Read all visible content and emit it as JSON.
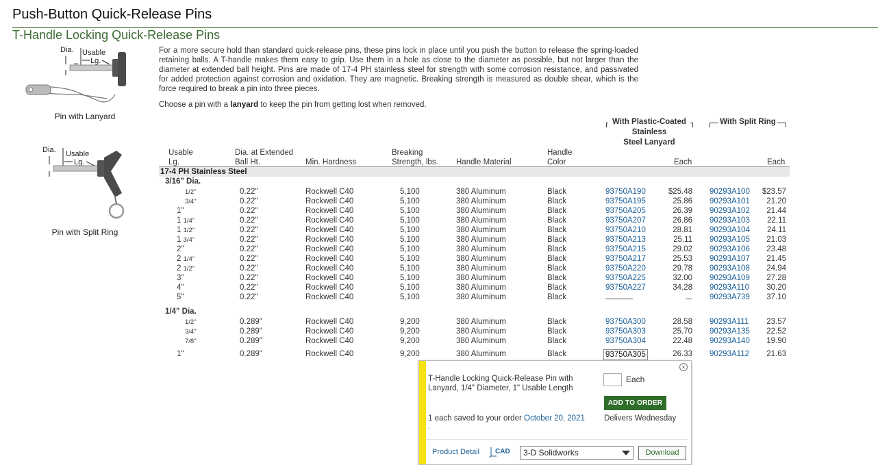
{
  "page_title": "Push-Button Quick-Release Pins",
  "sub_title": "T-Handle Locking Quick-Release Pins",
  "images": {
    "lanyard": {
      "label_dia": "Dia.",
      "label_usable": "Usable",
      "label_lg": "Lg.",
      "caption": "Pin with Lanyard"
    },
    "split_ring": {
      "label_dia": "Dia.",
      "label_usable": "Usable",
      "label_lg": "Lg.",
      "caption": "Pin with Split Ring"
    }
  },
  "description": "For a more secure hold than standard quick-release pins, these pins lock in place until you push the button to release the spring-loaded retaining balls. A T-handle makes them easy to grip. Use them in a hole as close to the diameter as possible, but not larger than the diameter at extended ball height. Pins are made of 17-4 PH stainless steel for strength with some corrosion resistance, and passivated for added protection against corrosion and oxidation. They are magnetic. Breaking strength is measured as double shear, which is the force required to break a pin into three pieces.",
  "choose": {
    "before": "Choose a pin with a ",
    "bold": "lanyard",
    "after": " to keep the pin from getting lost when removed."
  },
  "table": {
    "group_headers": {
      "lanyard": [
        "With Plastic-Coated",
        "Stainless",
        "Steel Lanyard"
      ],
      "split_ring": "With Split Ring"
    },
    "headers": {
      "usable_lg": [
        "Usable",
        "Lg."
      ],
      "dia": [
        "Dia. at Extended",
        "Ball Ht."
      ],
      "hardness": "Min. Hardness",
      "breaking": [
        "Breaking",
        "Strength, lbs."
      ],
      "material": "Handle Material",
      "color": [
        "Handle",
        "Color"
      ],
      "each1": "Each",
      "each2": "Each"
    },
    "material_row": "17-4 PH Stainless Steel",
    "sections": [
      {
        "dia_label": "3/16\" Dia.",
        "rows": [
          {
            "whole": "",
            "frac": "1/2\"",
            "dia": "0.22\"",
            "hard": "Rockwell C40",
            "brk": "5,100",
            "mat": "380 Aluminum",
            "col": "Black",
            "p1": "93750A190",
            "e1": "$25.48",
            "p2": "90293A100",
            "e2": "$23.57"
          },
          {
            "whole": "",
            "frac": "3/4\"",
            "dia": "0.22\"",
            "hard": "Rockwell C40",
            "brk": "5,100",
            "mat": "380 Aluminum",
            "col": "Black",
            "p1": "93750A195",
            "e1": "25.86",
            "p2": "90293A101",
            "e2": "21.20"
          },
          {
            "whole": "1\"",
            "frac": "",
            "dia": "0.22\"",
            "hard": "Rockwell C40",
            "brk": "5,100",
            "mat": "380 Aluminum",
            "col": "Black",
            "p1": "93750A205",
            "e1": "26.39",
            "p2": "90293A102",
            "e2": "21.44"
          },
          {
            "whole": "1 ",
            "frac": "1/4\"",
            "dia": "0.22\"",
            "hard": "Rockwell C40",
            "brk": "5,100",
            "mat": "380 Aluminum",
            "col": "Black",
            "p1": "93750A207",
            "e1": "26.86",
            "p2": "90293A103",
            "e2": "22.11"
          },
          {
            "whole": "1 ",
            "frac": "1/2\"",
            "dia": "0.22\"",
            "hard": "Rockwell C40",
            "brk": "5,100",
            "mat": "380 Aluminum",
            "col": "Black",
            "p1": "93750A210",
            "e1": "28.81",
            "p2": "90293A104",
            "e2": "24.11"
          },
          {
            "whole": "1 ",
            "frac": "3/4\"",
            "dia": "0.22\"",
            "hard": "Rockwell C40",
            "brk": "5,100",
            "mat": "380 Aluminum",
            "col": "Black",
            "p1": "93750A213",
            "e1": "25.11",
            "p2": "90293A105",
            "e2": "21.03"
          },
          {
            "whole": "2\"",
            "frac": "",
            "dia": "0.22\"",
            "hard": "Rockwell C40",
            "brk": "5,100",
            "mat": "380 Aluminum",
            "col": "Black",
            "p1": "93750A215",
            "e1": "29.02",
            "p2": "90293A106",
            "e2": "23.48"
          },
          {
            "whole": "2 ",
            "frac": "1/4\"",
            "dia": "0.22\"",
            "hard": "Rockwell C40",
            "brk": "5,100",
            "mat": "380 Aluminum",
            "col": "Black",
            "p1": "93750A217",
            "e1": "25.53",
            "p2": "90293A107",
            "e2": "21.45"
          },
          {
            "whole": "2 ",
            "frac": "1/2\"",
            "dia": "0.22\"",
            "hard": "Rockwell C40",
            "brk": "5,100",
            "mat": "380 Aluminum",
            "col": "Black",
            "p1": "93750A220",
            "e1": "29.78",
            "p2": "90293A108",
            "e2": "24.94"
          },
          {
            "whole": "3\"",
            "frac": "",
            "dia": "0.22\"",
            "hard": "Rockwell C40",
            "brk": "5,100",
            "mat": "380 Aluminum",
            "col": "Black",
            "p1": "93750A225",
            "e1": "32.00",
            "p2": "90293A109",
            "e2": "27.28"
          },
          {
            "whole": "4\"",
            "frac": "",
            "dia": "0.22\"",
            "hard": "Rockwell C40",
            "brk": "5,100",
            "mat": "380 Aluminum",
            "col": "Black",
            "p1": "93750A227",
            "e1": "34.28",
            "p2": "90293A110",
            "e2": "30.20"
          },
          {
            "whole": "5\"",
            "frac": "",
            "dia": "0.22\"",
            "hard": "Rockwell C40",
            "brk": "5,100",
            "mat": "380 Aluminum",
            "col": "Black",
            "p1": "",
            "e1": "",
            "p2": "90293A739",
            "e2": "37.10"
          }
        ]
      },
      {
        "dia_label": "1/4\" Dia.",
        "rows": [
          {
            "whole": "",
            "frac": "1/2\"",
            "dia": "0.289\"",
            "hard": "Rockwell C40",
            "brk": "9,200",
            "mat": "380 Aluminum",
            "col": "Black",
            "p1": "93750A300",
            "e1": "28.58",
            "p2": "90293A111",
            "e2": "23.57"
          },
          {
            "whole": "",
            "frac": "3/4\"",
            "dia": "0.289\"",
            "hard": "Rockwell C40",
            "brk": "9,200",
            "mat": "380 Aluminum",
            "col": "Black",
            "p1": "93750A303",
            "e1": "25.70",
            "p2": "90293A135",
            "e2": "22.52"
          },
          {
            "whole": "",
            "frac": "7/8\"",
            "dia": "0.289\"",
            "hard": "Rockwell C40",
            "brk": "9,200",
            "mat": "380 Aluminum",
            "col": "Black",
            "p1": "93750A304",
            "e1": "22.48",
            "p2": "90293A140",
            "e2": "19.90"
          },
          {
            "whole": "1\"",
            "frac": "",
            "dia": "0.289\"",
            "hard": "Rockwell C40",
            "brk": "9,200",
            "mat": "380 Aluminum",
            "col": "Black",
            "p1": "93750A305",
            "e1": "26.33",
            "p2": "90293A112",
            "e2": "21.63",
            "selected": true
          }
        ]
      }
    ]
  },
  "popup": {
    "close": "×",
    "description": "T-Handle Locking Quick-Release Pin with Lanyard, 1/4\" Diameter, 1\" Usable Length",
    "qty_value": "",
    "qty_label": "Each",
    "add_to_order": "ADD TO ORDER",
    "saved_text": "1 each saved to your order ",
    "saved_date": "October 20, 2021",
    "dot": ".",
    "delivers": "Delivers Wednesday",
    "product_detail": "Product Detail",
    "cad_label": "CAD",
    "cad_selected": "3-D Solidworks",
    "download": "Download"
  },
  "colors": {
    "accent_green": "#3d6b35",
    "link_blue": "#1a5e96",
    "popup_stripe": "#f5e211",
    "button_green": "#2f6d2b"
  }
}
